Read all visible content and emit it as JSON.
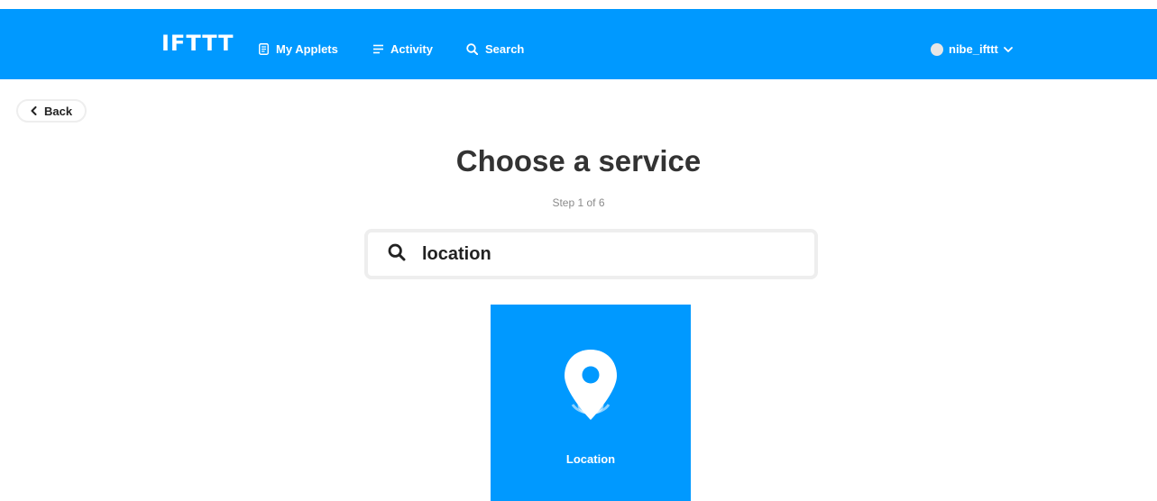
{
  "header": {
    "logo": "IFTTT",
    "nav": {
      "my_applets": "My Applets",
      "activity": "Activity",
      "search": "Search"
    },
    "user": {
      "username": "nibe_ifttt"
    },
    "brand_color": "#0099ff"
  },
  "back": {
    "label": "Back"
  },
  "page": {
    "title": "Choose a service",
    "step": "Step 1 of 6"
  },
  "search": {
    "value": "location",
    "icon": "search-icon"
  },
  "results": [
    {
      "name": "Location",
      "icon": "location-pin-icon",
      "color": "#0099ff"
    }
  ]
}
